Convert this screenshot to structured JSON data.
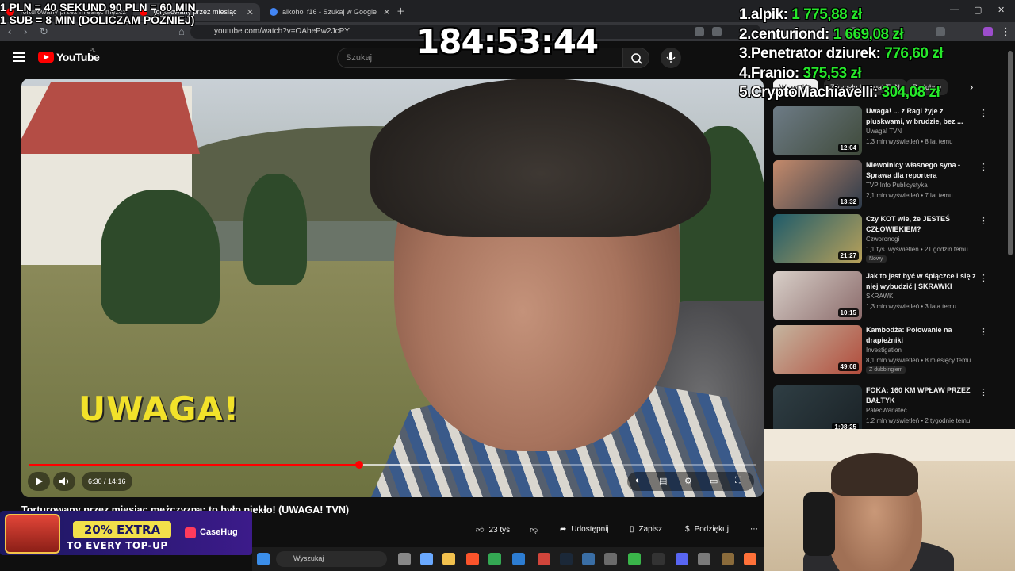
{
  "browser": {
    "tabs": [
      {
        "title": "Torturowany przez miesiąc mężczyzna...",
        "active": false
      },
      {
        "title": "Torturowany przez miesiąc",
        "active": true
      },
      {
        "title": "alkohol f16 - Szukaj w Google",
        "active": false
      }
    ],
    "url": "youtube.com/watch?v=OAbePw2JcPY"
  },
  "youtube": {
    "wordmark": "YouTube",
    "country": "PL",
    "search_placeholder": "Szukaj",
    "chips": [
      "Wszystkie",
      "Z kanału Uwaga! TVN",
      "Podobne"
    ],
    "video": {
      "overlay_text": "UWAGA!",
      "time": "6:30 / 14:16",
      "progress_fraction": 0.4545,
      "buffer_fraction": 0.6,
      "title": "Torturowany przez miesiąc mężczyzna: to było piekło! (UWAGA! TVN)"
    },
    "actions": {
      "likes": "23 tys.",
      "share": "Udostępnij",
      "save": "Zapisz",
      "thanks": "Podziękuj"
    },
    "recommendations": [
      {
        "title": "Uwaga! ... z Ragi żyje z pluskwami, w brudzie, bez ...",
        "channel": "Uwaga! TVN",
        "meta": "1,3 mln wyświetleń • 8 lat temu",
        "duration": "12:04",
        "badge": ""
      },
      {
        "title": "Niewolnicy własnego syna - Sprawa dla reportera",
        "channel": "TVP Info Publicystyka",
        "meta": "2,1 mln wyświetleń • 7 lat temu",
        "duration": "13:32",
        "badge": ""
      },
      {
        "title": "Czy KOT wie, że JESTEŚ CZŁOWIEKIEM?",
        "channel": "Czworonogi",
        "meta": "1,1 tys. wyświetleń • 21 godzin temu",
        "duration": "21:27",
        "badge": "Nowy"
      },
      {
        "title": "Jak to jest być w śpiączce i się z niej wybudzić | SKRAWKI",
        "channel": "SKRAWKI",
        "meta": "1,3 mln wyświetleń • 3 lata temu",
        "duration": "10:15",
        "badge": ""
      },
      {
        "title": "Kambodża: Polowanie na drapieżniki",
        "channel": "Investigation",
        "meta": "8,1 mln wyświetleń • 8 miesięcy temu",
        "duration": "49:08",
        "badge": "Z dubbingiem"
      },
      {
        "title": "FOKA: 160 KM WPŁAW PRZEZ BAŁTYK",
        "channel": "PatecWariatec",
        "meta": "1,2 mln wyświetleń • 2 tygodnie temu",
        "duration": "1:08:25",
        "badge": ""
      }
    ]
  },
  "stream_overlay": {
    "rules": [
      "1 PLN = 40 SEKUND 90 PLN = 60 MIN",
      "1 SUB = 8 MIN (DOLICZAM PÓŹNIEJ)"
    ],
    "timer": "184:53:44",
    "leaderboard": [
      {
        "rank": "1.",
        "name": "alpik:",
        "amount": "1 775,88 zł"
      },
      {
        "rank": "2.",
        "name": "centuriond:",
        "amount": "1 669,08 zł"
      },
      {
        "rank": "3.",
        "name": "Penetrator dziurek:",
        "amount": "776,60 zł"
      },
      {
        "rank": "4.",
        "name": "Franio:",
        "amount": "375,53 zł"
      },
      {
        "rank": "5.",
        "name": "CryptoMachiavelli:",
        "amount": "304,08 zł"
      }
    ],
    "promo": {
      "line1": "20% EXTRA",
      "line2": "TO EVERY TOP-UP",
      "brand": "CaseHug"
    }
  },
  "taskbar": {
    "search_placeholder": "Wyszukaj"
  },
  "colors": {
    "accent": "#ff0000",
    "leaderboard_amount": "#26e82a",
    "promo_yellow": "#f2e04a"
  }
}
